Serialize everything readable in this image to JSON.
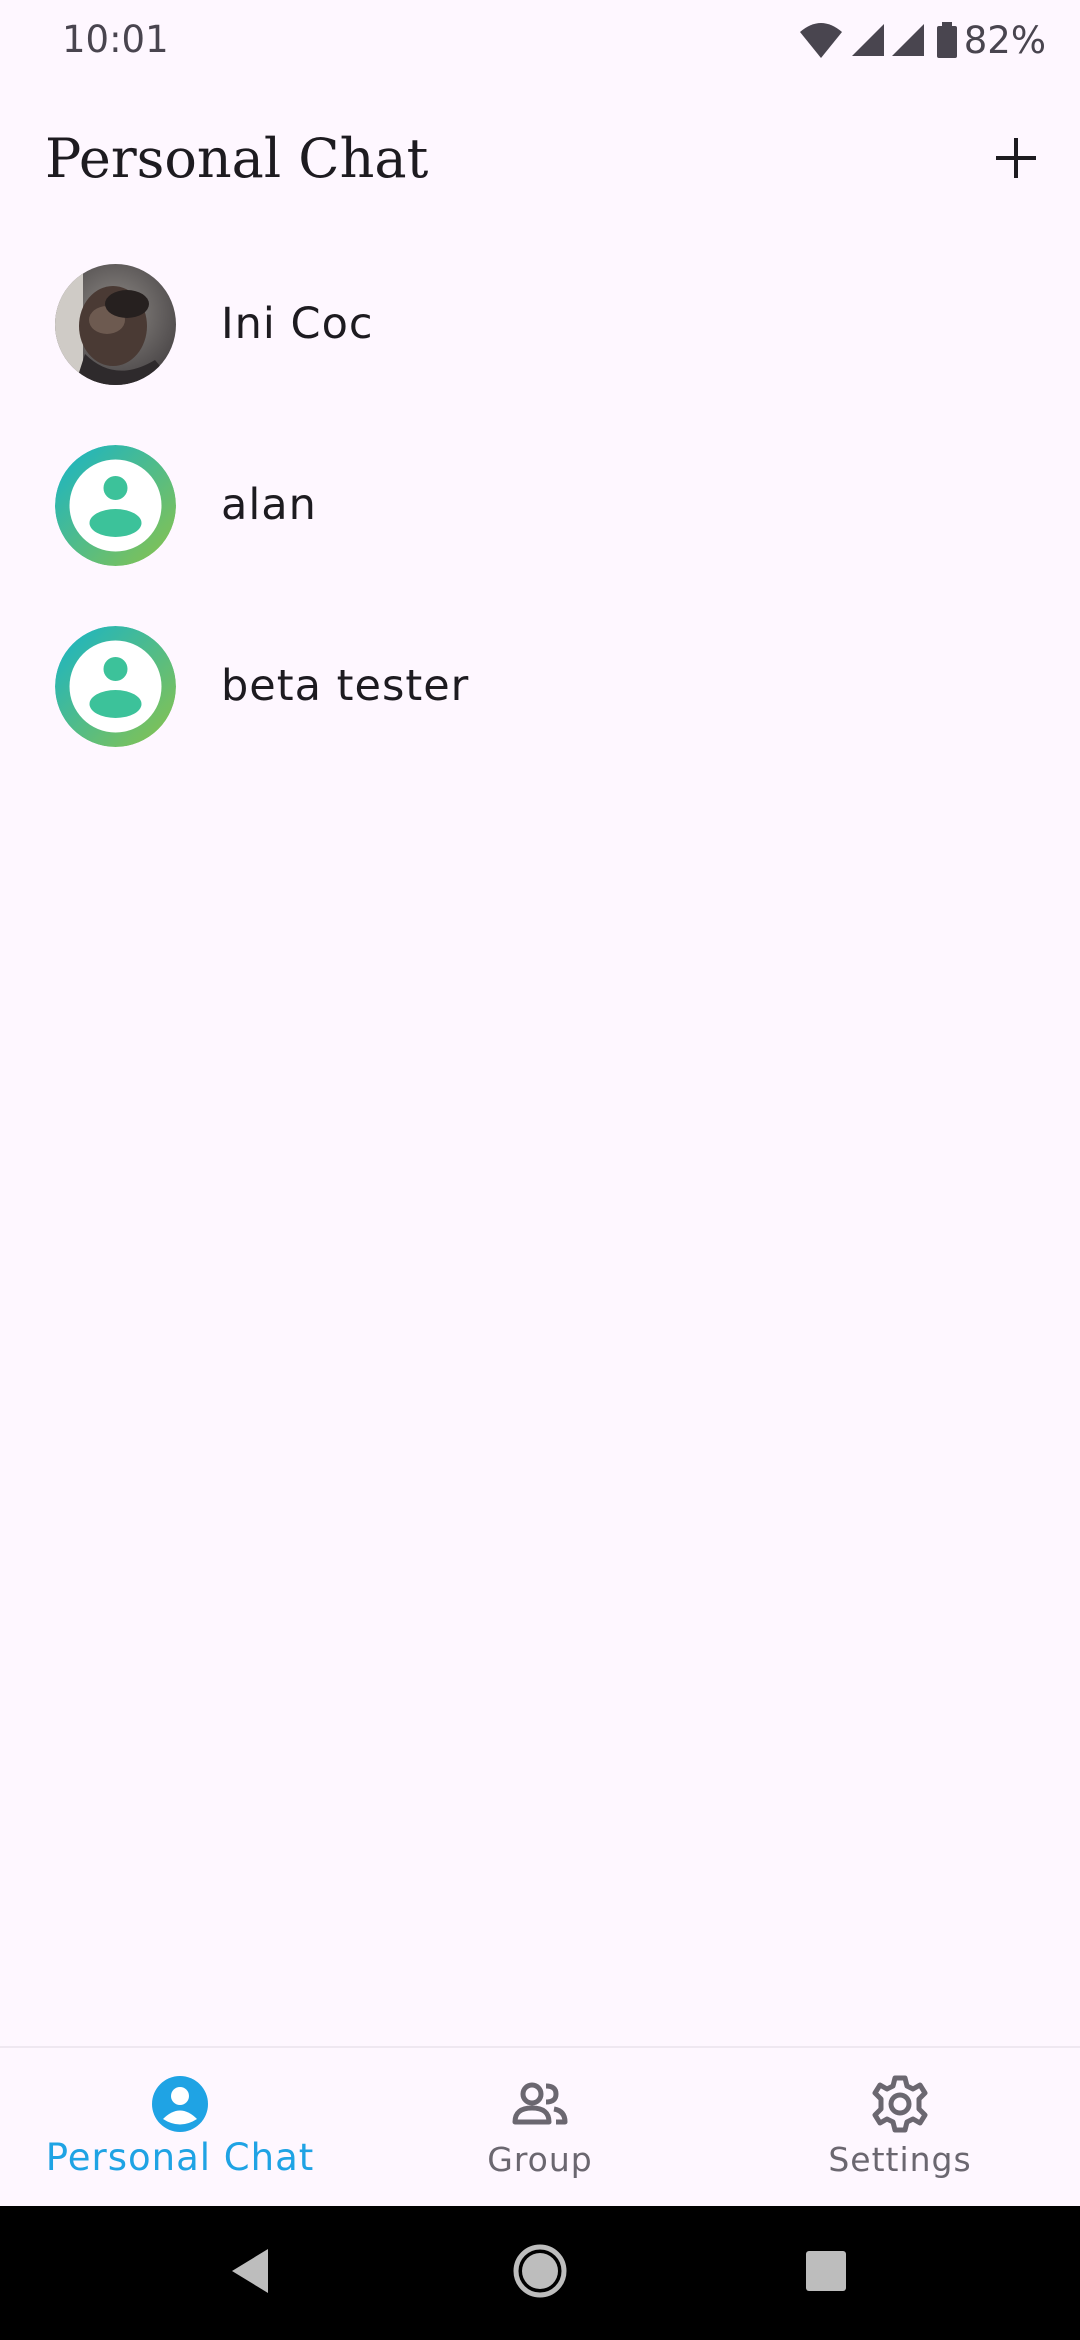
{
  "status_bar": {
    "time": "10:01",
    "battery": "82%",
    "icons": [
      "wifi-icon",
      "signal-icon",
      "signal-icon",
      "battery-icon"
    ]
  },
  "header": {
    "title": "Personal Chat",
    "add_icon": "plus-icon"
  },
  "chats": [
    {
      "name": "Ini Coc",
      "avatar": "photo"
    },
    {
      "name": "alan",
      "avatar": "default-person-icon"
    },
    {
      "name": "beta tester",
      "avatar": "default-person-icon"
    }
  ],
  "bottom_nav": {
    "items": [
      {
        "label": "Personal Chat",
        "icon": "person-icon",
        "active": true
      },
      {
        "label": "Group",
        "icon": "group-icon",
        "active": false
      },
      {
        "label": "Settings",
        "icon": "gear-icon",
        "active": false
      }
    ]
  },
  "system_nav": {
    "buttons": [
      "back-icon",
      "home-icon",
      "recents-icon"
    ]
  },
  "colors": {
    "background": "#FEF7FF",
    "accent": "#1FA3E4",
    "avatar_gradient_start": "#16B4C9",
    "avatar_gradient_end": "#8BC34A",
    "avatar_figure": "#3CC29A"
  }
}
